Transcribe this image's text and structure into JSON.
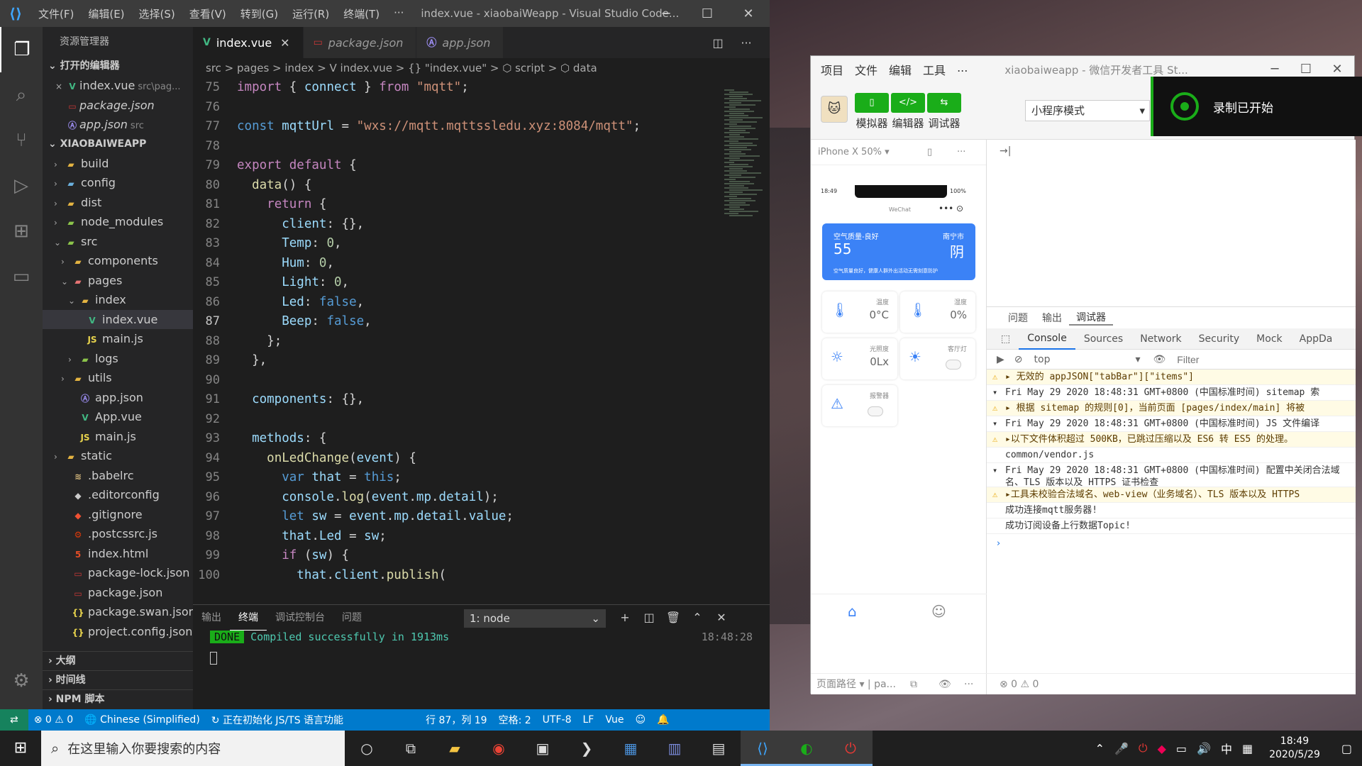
{
  "vscode": {
    "title_menus": [
      "文件(F)",
      "编辑(E)",
      "选择(S)",
      "查看(V)",
      "转到(G)",
      "运行(R)",
      "终端(T)",
      "···"
    ],
    "window_title": "index.vue - xiaobaiWeapp - Visual Studio Code...",
    "sidebar_title": "资源管理器",
    "open_editors_label": "打开的编辑器",
    "open_editors": [
      {
        "name": "index.vue",
        "desc": "src\\pag...",
        "icon": "V",
        "color": "#41b883",
        "close": "×"
      },
      {
        "name": "package.json",
        "desc": "",
        "icon": "▭",
        "color": "#cb3837",
        "close": ""
      },
      {
        "name": "app.json",
        "desc": "src",
        "icon": "Ⓐ",
        "color": "#9b8cf0",
        "close": ""
      }
    ],
    "project_label": "XIAOBAIWEAPP",
    "tree": [
      {
        "name": "build",
        "twisty": "›",
        "icon": "▰",
        "color": "#e3b341",
        "indent": 16
      },
      {
        "name": "config",
        "twisty": "›",
        "icon": "▰",
        "color": "#6ab0de",
        "indent": 16
      },
      {
        "name": "dist",
        "twisty": "›",
        "icon": "▰",
        "color": "#e3b341",
        "indent": 16
      },
      {
        "name": "node_modules",
        "twisty": "›",
        "icon": "▰",
        "color": "#8bc34a",
        "indent": 16
      },
      {
        "name": "src",
        "twisty": "⌄",
        "icon": "▰",
        "color": "#8bc34a",
        "indent": 16
      },
      {
        "name": "components",
        "twisty": "›",
        "icon": "▰",
        "color": "#e3b341",
        "indent": 26
      },
      {
        "name": "pages",
        "twisty": "⌄",
        "icon": "▰",
        "color": "#e57373",
        "indent": 26
      },
      {
        "name": "index",
        "twisty": "⌄",
        "icon": "▰",
        "color": "#e3b341",
        "indent": 36
      },
      {
        "name": "index.vue",
        "twisty": "",
        "icon": "V",
        "color": "#41b883",
        "indent": 46,
        "selected": true
      },
      {
        "name": "main.js",
        "twisty": "",
        "icon": "JS",
        "color": "#e8d44d",
        "indent": 46
      },
      {
        "name": "logs",
        "twisty": "›",
        "icon": "▰",
        "color": "#8bc34a",
        "indent": 36
      },
      {
        "name": "utils",
        "twisty": "›",
        "icon": "▰",
        "color": "#e3b341",
        "indent": 26
      },
      {
        "name": "app.json",
        "twisty": "",
        "icon": "Ⓐ",
        "color": "#9b8cf0",
        "indent": 36
      },
      {
        "name": "App.vue",
        "twisty": "",
        "icon": "V",
        "color": "#41b883",
        "indent": 36
      },
      {
        "name": "main.js",
        "twisty": "",
        "icon": "JS",
        "color": "#e8d44d",
        "indent": 36
      },
      {
        "name": "static",
        "twisty": "›",
        "icon": "▰",
        "color": "#e3b341",
        "indent": 16
      },
      {
        "name": ".babelrc",
        "twisty": "",
        "icon": "≋",
        "color": "#d7ba7d",
        "indent": 26
      },
      {
        "name": ".editorconfig",
        "twisty": "",
        "icon": "◆",
        "color": "#ccc",
        "indent": 26
      },
      {
        "name": ".gitignore",
        "twisty": "",
        "icon": "◆",
        "color": "#f05133",
        "indent": 26
      },
      {
        "name": ".postcssrc.js",
        "twisty": "",
        "icon": "⚙",
        "color": "#dd3a0a",
        "indent": 26
      },
      {
        "name": "index.html",
        "twisty": "",
        "icon": "5",
        "color": "#e44d26",
        "indent": 26
      },
      {
        "name": "package-lock.json",
        "twisty": "",
        "icon": "▭",
        "color": "#cb3837",
        "indent": 26
      },
      {
        "name": "package.json",
        "twisty": "",
        "icon": "▭",
        "color": "#cb3837",
        "indent": 26
      },
      {
        "name": "package.swan.json",
        "twisty": "",
        "icon": "{}",
        "color": "#e8d44d",
        "indent": 26
      },
      {
        "name": "project.config.json",
        "twisty": "",
        "icon": "{}",
        "color": "#e8d44d",
        "indent": 26
      }
    ],
    "bottom_sections": [
      "大纲",
      "时间线",
      "NPM 脚本"
    ],
    "tabs": [
      {
        "label": "index.vue",
        "icon": "V",
        "color": "#41b883",
        "active": true
      },
      {
        "label": "package.json",
        "icon": "▭",
        "color": "#cb3837",
        "active": false
      },
      {
        "label": "app.json",
        "icon": "Ⓐ",
        "color": "#9b8cf0",
        "active": false
      }
    ],
    "breadcrumb": "src > pages > index > V index.vue > {} \"index.vue\" > ⬡ script > ⬡ data",
    "code_lines": [
      {
        "no": "75",
        "html": "<span class='k'>import</span> <span class='p'>{</span> <span class='v'>connect</span> <span class='p'>}</span> <span class='k'>from</span> <span class='s'>\"mqtt\"</span><span class='p'>;</span>"
      },
      {
        "no": "76",
        "html": ""
      },
      {
        "no": "77",
        "html": "<span class='b'>const</span> <span class='v'>mqttUrl</span> <span class='p'>=</span> <span class='s'>\"wxs://mqtt.mqttssledu.xyz:8084/mqtt\"</span><span class='p'>;</span>"
      },
      {
        "no": "78",
        "html": ""
      },
      {
        "no": "79",
        "html": "<span class='k'>export</span> <span class='k'>default</span> <span class='p'>{</span>"
      },
      {
        "no": "80",
        "html": "  <span class='f'>data</span><span class='p'>() {</span>"
      },
      {
        "no": "81",
        "html": "    <span class='k'>return</span> <span class='p'>{</span>"
      },
      {
        "no": "82",
        "html": "      <span class='v'>client</span><span class='p'>: {},</span>"
      },
      {
        "no": "83",
        "html": "      <span class='v'>Temp</span><span class='p'>:</span> <span class='n'>0</span><span class='p'>,</span>"
      },
      {
        "no": "84",
        "html": "      <span class='v'>Hum</span><span class='p'>:</span> <span class='n'>0</span><span class='p'>,</span>"
      },
      {
        "no": "85",
        "html": "      <span class='v'>Light</span><span class='p'>:</span> <span class='n'>0</span><span class='p'>,</span>"
      },
      {
        "no": "86",
        "html": "      <span class='v'>Led</span><span class='p'>:</span> <span class='b'>false</span><span class='p'>,</span>"
      },
      {
        "no": "87",
        "html": "      <span class='v'>Beep</span><span class='p'>:</span> <span class='b'>false</span><span class='p'>,</span>",
        "cur": true
      },
      {
        "no": "88",
        "html": "    <span class='p'>};</span>"
      },
      {
        "no": "89",
        "html": "  <span class='p'>},</span>"
      },
      {
        "no": "90",
        "html": ""
      },
      {
        "no": "91",
        "html": "  <span class='v'>components</span><span class='p'>: {},</span>"
      },
      {
        "no": "92",
        "html": ""
      },
      {
        "no": "93",
        "html": "  <span class='v'>methods</span><span class='p'>: {</span>"
      },
      {
        "no": "94",
        "html": "    <span class='f'>onLedChange</span><span class='p'>(</span><span class='v'>event</span><span class='p'>) {</span>"
      },
      {
        "no": "95",
        "html": "      <span class='b'>var</span> <span class='v'>that</span> <span class='p'>=</span> <span class='b'>this</span><span class='p'>;</span>"
      },
      {
        "no": "96",
        "html": "      <span class='v'>console</span><span class='p'>.</span><span class='f'>log</span><span class='p'>(</span><span class='v'>event</span><span class='p'>.</span><span class='v'>mp</span><span class='p'>.</span><span class='v'>detail</span><span class='p'>);</span>"
      },
      {
        "no": "97",
        "html": "      <span class='b'>let</span> <span class='v'>sw</span> <span class='p'>=</span> <span class='v'>event</span><span class='p'>.</span><span class='v'>mp</span><span class='p'>.</span><span class='v'>detail</span><span class='p'>.</span><span class='v'>value</span><span class='p'>;</span>"
      },
      {
        "no": "98",
        "html": "      <span class='v'>that</span><span class='p'>.</span><span class='v'>Led</span> <span class='p'>=</span> <span class='v'>sw</span><span class='p'>;</span>"
      },
      {
        "no": "99",
        "html": "      <span class='k'>if</span> <span class='p'>(</span><span class='v'>sw</span><span class='p'>) {</span>"
      },
      {
        "no": "100",
        "html": "        <span class='v'>that</span><span class='p'>.</span><span class='v'>client</span><span class='p'>.</span><span class='f'>publish</span><span class='p'>(</span>"
      }
    ],
    "panel_tabs": [
      "输出",
      "终端",
      "调试控制台",
      "问题"
    ],
    "panel_active": 1,
    "terminal_select": "1: node",
    "terminal_done": "DONE",
    "terminal_line": "Compiled successfully in 1913ms",
    "terminal_time": "18:48:28",
    "status": {
      "errors": "⊗ 0 ⚠ 0",
      "language": "Chinese (Simplified)",
      "init": "正在初始化 JS/TS 语言功能",
      "position": "行 87，列 19",
      "spaces": "空格: 2",
      "encoding": "UTF-8",
      "eol": "LF",
      "mode": "Vue"
    }
  },
  "wechat": {
    "menus": [
      "项目",
      "文件",
      "编辑",
      "工具",
      "..."
    ],
    "title": "xiaobaiweapp - 微信开发者工具 St...",
    "tools": [
      {
        "icon": "▯",
        "label": "模拟器"
      },
      {
        "icon": "</>",
        "label": "编辑器"
      },
      {
        "icon": "⇆",
        "label": "调试器"
      }
    ],
    "mode": "小程序模式",
    "device": "iPhone X 50% ▾",
    "phone": {
      "time": "18:49",
      "battery": "100%",
      "app_name": "WeChat",
      "aq_label": "空气质量-良好",
      "aq_value": "55",
      "city": "南宁市",
      "weather": "阴",
      "aq_note": "空气质量良好，健康人群外出活动无需刻意防护",
      "sensors": [
        {
          "label": "温度",
          "value": "0°C",
          "icon": "🌡"
        },
        {
          "label": "湿度",
          "value": "0%",
          "icon": "🌡"
        },
        {
          "label": "光照度",
          "value": "0Lx",
          "icon": "☼"
        },
        {
          "label": "客厅灯",
          "value": "",
          "icon": "☀"
        },
        {
          "label": "报警器",
          "value": "",
          "icon": "⚠"
        }
      ]
    },
    "sim_footer": "页面路径 ▾ | pa...",
    "dbg_tabs": [
      "问题",
      "输出",
      "调试器"
    ],
    "console_tabs": [
      "Console",
      "Sources",
      "Network",
      "Security",
      "Mock",
      "AppDa"
    ],
    "context": "top",
    "filter_placeholder": "Filter",
    "console": [
      {
        "type": "warn",
        "text": "▸ 无效的 appJSON[\"tabBar\"][\"items\"]"
      },
      {
        "type": "group",
        "text": "Fri May 29 2020 18:48:31 GMT+0800 (中国标准时间) sitemap 索"
      },
      {
        "type": "warn",
        "text": "▸ 根据 sitemap 的规则[0]，当前页面 [pages/index/main] 将被"
      },
      {
        "type": "group",
        "text": "Fri May 29 2020 18:48:31 GMT+0800 (中国标准时间) JS 文件编译"
      },
      {
        "type": "warn",
        "text": "▸以下文件体积超过 500KB，已跳过压缩以及 ES6 转 ES5 的处理。"
      },
      {
        "type": "log",
        "text": "common/vendor.js"
      },
      {
        "type": "group",
        "text": "Fri May 29 2020 18:48:31 GMT+0800 (中国标准时间) 配置中关闭合法域名、TLS 版本以及 HTTPS 证书检查"
      },
      {
        "type": "warn",
        "text": "▸工具未校验合法域名、web-view（业务域名）、TLS 版本以及 HTTPS"
      },
      {
        "type": "log",
        "text": "成功连接mqtt服务器!"
      },
      {
        "type": "log",
        "text": "成功订阅设备上行数据Topic!"
      }
    ],
    "dbg_footer": "⊗ 0 ⚠ 0"
  },
  "recording": "录制已开始",
  "taskbar": {
    "search_placeholder": "在这里输入你要搜索的内容",
    "time": "18:49",
    "date": "2020/5/29",
    "ime": "中"
  }
}
